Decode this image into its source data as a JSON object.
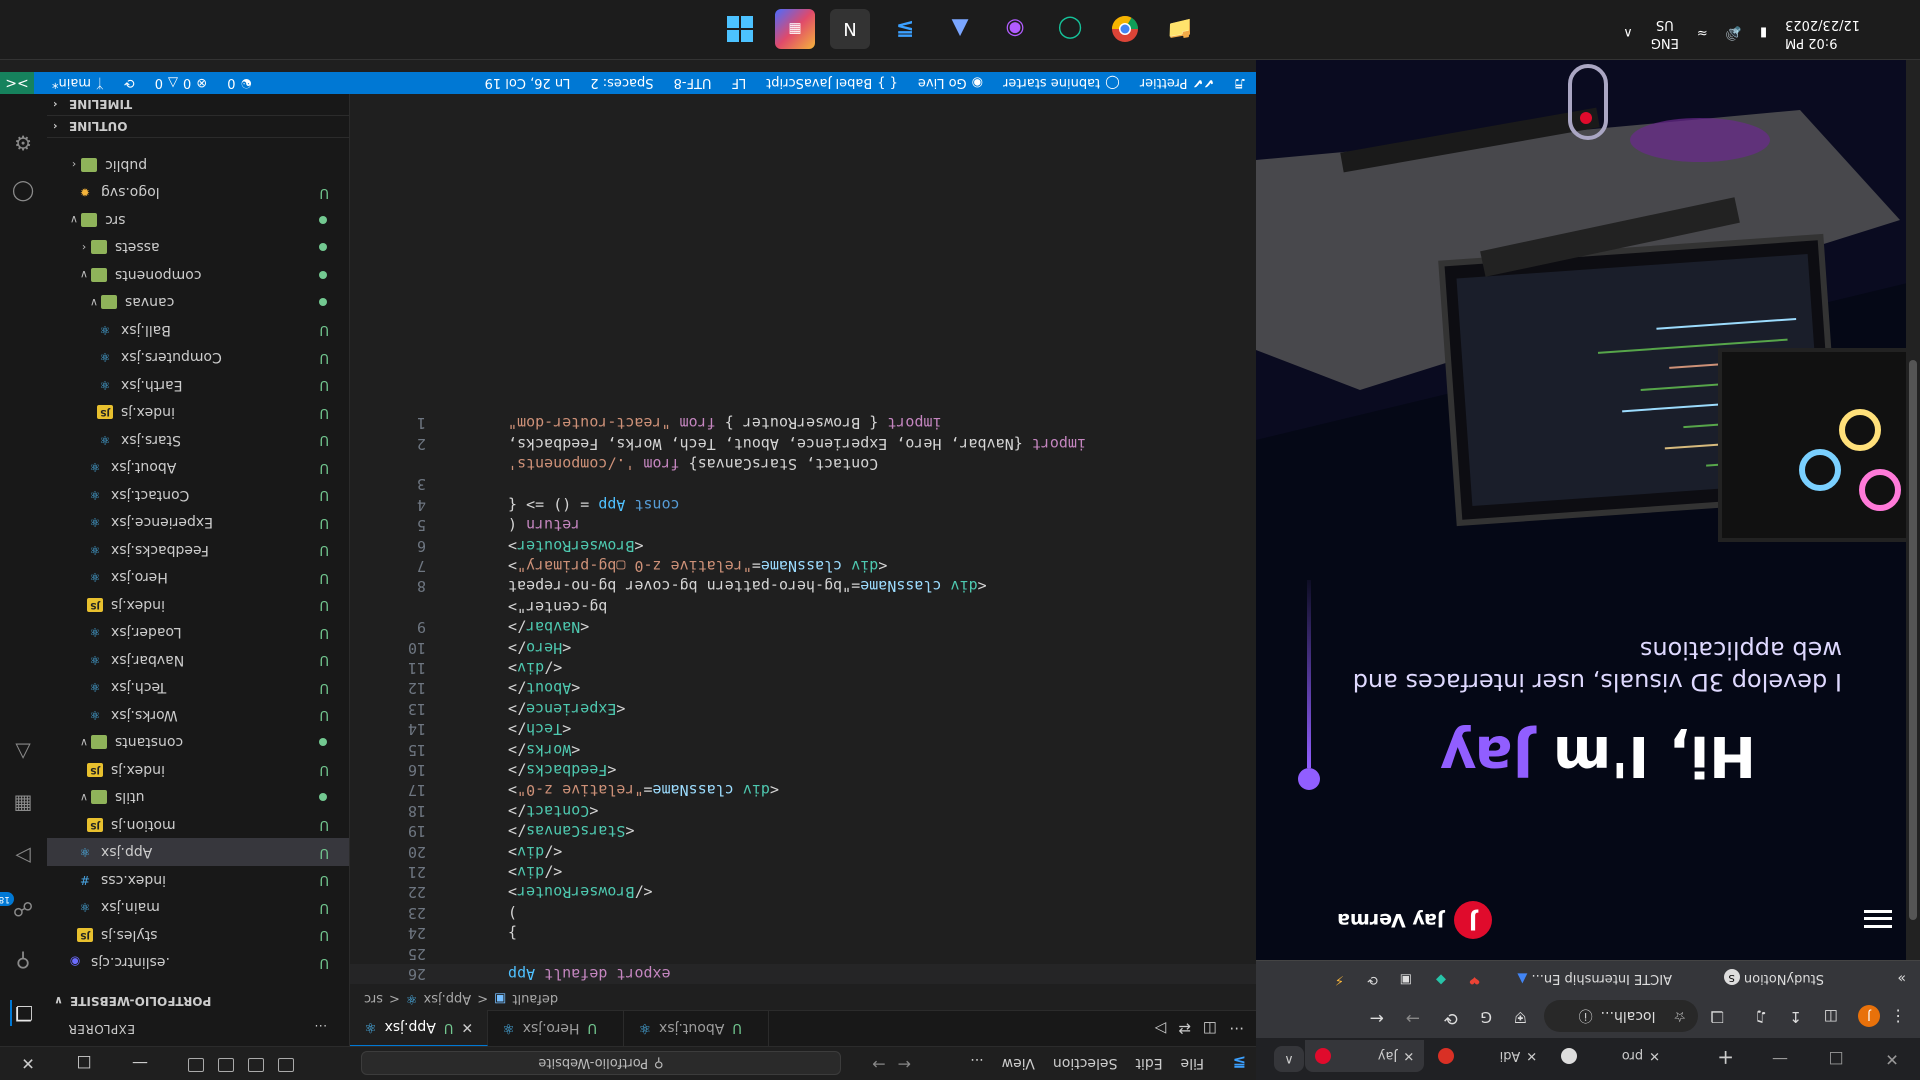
{
  "taskbar": {
    "time": "9:02 PM",
    "date": "12/23/2023",
    "lang_top": "ENG",
    "lang_bottom": "US",
    "apps": [
      "windows-start",
      "store",
      "notion",
      "vscode",
      "prism",
      "obs",
      "grammarly",
      "chrome",
      "file-explorer"
    ]
  },
  "vscode": {
    "menu": [
      "File",
      "Edit",
      "Selection",
      "View",
      "..."
    ],
    "search": "Portfolio-Website",
    "explorer_title": "EXPLORER",
    "explorer_more": "...",
    "project": "PORTFOLIO-WEBSITE",
    "sections": {
      "outline": "OUTLINE",
      "timeline": "TIMELINE"
    },
    "activity_badge": "180",
    "tabs": [
      {
        "label": "App.jsx",
        "mark": "U",
        "active": true
      },
      {
        "label": "Hero.jsx",
        "mark": "U",
        "active": false
      },
      {
        "label": "About.jsx",
        "mark": "U",
        "active": false
      }
    ],
    "breadcrumbs": [
      "src",
      "App.jsx",
      "default"
    ],
    "tree": [
      {
        "label": "public",
        "kind": "folder",
        "depth": 0,
        "status": ""
      },
      {
        "label": "logo.svg",
        "kind": "svg",
        "depth": 1,
        "status": "U"
      },
      {
        "label": "src",
        "kind": "folder",
        "depth": 0,
        "status": "dot",
        "open": true
      },
      {
        "label": "assets",
        "kind": "folder",
        "depth": 1,
        "status": "dot"
      },
      {
        "label": "components",
        "kind": "folder",
        "depth": 1,
        "status": "dot",
        "open": true
      },
      {
        "label": "canvas",
        "kind": "folder",
        "depth": 2,
        "status": "dot",
        "open": true
      },
      {
        "label": "Ball.jsx",
        "kind": "react",
        "depth": 3,
        "status": "U"
      },
      {
        "label": "Computers.jsx",
        "kind": "react",
        "depth": 3,
        "status": "U"
      },
      {
        "label": "Earth.jsx",
        "kind": "react",
        "depth": 3,
        "status": "U"
      },
      {
        "label": "index.js",
        "kind": "js",
        "depth": 3,
        "status": "U"
      },
      {
        "label": "Stars.jsx",
        "kind": "react",
        "depth": 3,
        "status": "U"
      },
      {
        "label": "About.jsx",
        "kind": "react",
        "depth": 2,
        "status": "U"
      },
      {
        "label": "Contact.jsx",
        "kind": "react",
        "depth": 2,
        "status": "U"
      },
      {
        "label": "Experience.jsx",
        "kind": "react",
        "depth": 2,
        "status": "U"
      },
      {
        "label": "Feedbacks.jsx",
        "kind": "react",
        "depth": 2,
        "status": "U"
      },
      {
        "label": "Hero.jsx",
        "kind": "react",
        "depth": 2,
        "status": "U"
      },
      {
        "label": "index.js",
        "kind": "js",
        "depth": 2,
        "status": "U"
      },
      {
        "label": "Loader.jsx",
        "kind": "react",
        "depth": 2,
        "status": "U"
      },
      {
        "label": "Navbar.jsx",
        "kind": "react",
        "depth": 2,
        "status": "U"
      },
      {
        "label": "Tech.jsx",
        "kind": "react",
        "depth": 2,
        "status": "U"
      },
      {
        "label": "Works.jsx",
        "kind": "react",
        "depth": 2,
        "status": "U"
      },
      {
        "label": "constants",
        "kind": "folder",
        "depth": 1,
        "status": "dot",
        "open": true
      },
      {
        "label": "index.js",
        "kind": "js",
        "depth": 2,
        "status": "U"
      },
      {
        "label": "utils",
        "kind": "folder",
        "depth": 1,
        "status": "dot",
        "open": true
      },
      {
        "label": "motion.js",
        "kind": "js",
        "depth": 2,
        "status": "U"
      },
      {
        "label": "App.jsx",
        "kind": "react",
        "depth": 1,
        "status": "U",
        "selected": true
      },
      {
        "label": "index.css",
        "kind": "css",
        "depth": 1,
        "status": "U"
      },
      {
        "label": "main.jsx",
        "kind": "react",
        "depth": 1,
        "status": "U"
      },
      {
        "label": "styles.js",
        "kind": "js",
        "depth": 1,
        "status": "U"
      },
      {
        "label": ".eslintrc.cjs",
        "kind": "eslint",
        "depth": 0,
        "status": "U"
      }
    ],
    "code": [
      {
        "n": "1",
        "t": "import { BrowserRouter } from \"react-router-dom\""
      },
      {
        "n": "2",
        "t": "import {Navbar, Hero, Experience, About, Tech, Works, Feedbacks,"
      },
      {
        "n": "",
        "t": "Contact, StarsCanvas} from './components'"
      },
      {
        "n": "3",
        "t": ""
      },
      {
        "n": "4",
        "t": "const App = () => {"
      },
      {
        "n": "5",
        "t": "  return ("
      },
      {
        "n": "6",
        "t": "    <BrowserRouter>"
      },
      {
        "n": "7",
        "t": "      <div className=\"relative z-0 ▢bg-primary\">"
      },
      {
        "n": "8",
        "t": "        <div className=\"bg-hero-pattern bg-cover bg-no-repeat"
      },
      {
        "n": "",
        "t": "        bg-center\">"
      },
      {
        "n": "9",
        "t": "          <Navbar/>"
      },
      {
        "n": "10",
        "t": "          <Hero/>"
      },
      {
        "n": "11",
        "t": "        </div>"
      },
      {
        "n": "12",
        "t": "        <About/>"
      },
      {
        "n": "13",
        "t": "        <Experience/>"
      },
      {
        "n": "14",
        "t": "        <Tech/>"
      },
      {
        "n": "15",
        "t": "        <Works/>"
      },
      {
        "n": "16",
        "t": "        <Feedbacks/>"
      },
      {
        "n": "17",
        "t": "        <div className=\"relative z-0\">"
      },
      {
        "n": "18",
        "t": "          <Contact/>"
      },
      {
        "n": "19",
        "t": "          <StarsCanvas/>"
      },
      {
        "n": "20",
        "t": "        </div>"
      },
      {
        "n": "21",
        "t": "      </div>"
      },
      {
        "n": "22",
        "t": "    </BrowserRouter>"
      },
      {
        "n": "23",
        "t": "  )"
      },
      {
        "n": "24",
        "t": "}"
      },
      {
        "n": "25",
        "t": ""
      },
      {
        "n": "26",
        "t": "export default App"
      }
    ],
    "status": {
      "branch": "main*",
      "errors": "0",
      "warnings": "0",
      "ports": "0",
      "cursor": "Ln 26, Col 19",
      "spaces": "Spaces: 2",
      "encoding": "UTF-8",
      "eol": "LF",
      "language": "Babel JavaScript",
      "golive": "Go Live",
      "tabnine": "tabnine starter",
      "prettier": "Prettier"
    }
  },
  "browser": {
    "tabs": [
      {
        "label": "Jay",
        "active": true
      },
      {
        "label": "Adi",
        "active": false
      },
      {
        "label": "pro",
        "active": false
      }
    ],
    "omnibox": "localh...",
    "bookmarks": [
      "AICTE Internship En...",
      "StudyNotion"
    ],
    "page": {
      "brand": "Jay Verma",
      "logo_letter": "J",
      "hero_prefix": "Hi, I'm ",
      "hero_name": "Jay",
      "hero_sub": "I develop 3D visuals, user interfaces and web applications"
    }
  },
  "colors": {
    "accent": "#0078d4",
    "portfolio_purple": "#915eff",
    "portfolio_red": "#e00b2c"
  }
}
